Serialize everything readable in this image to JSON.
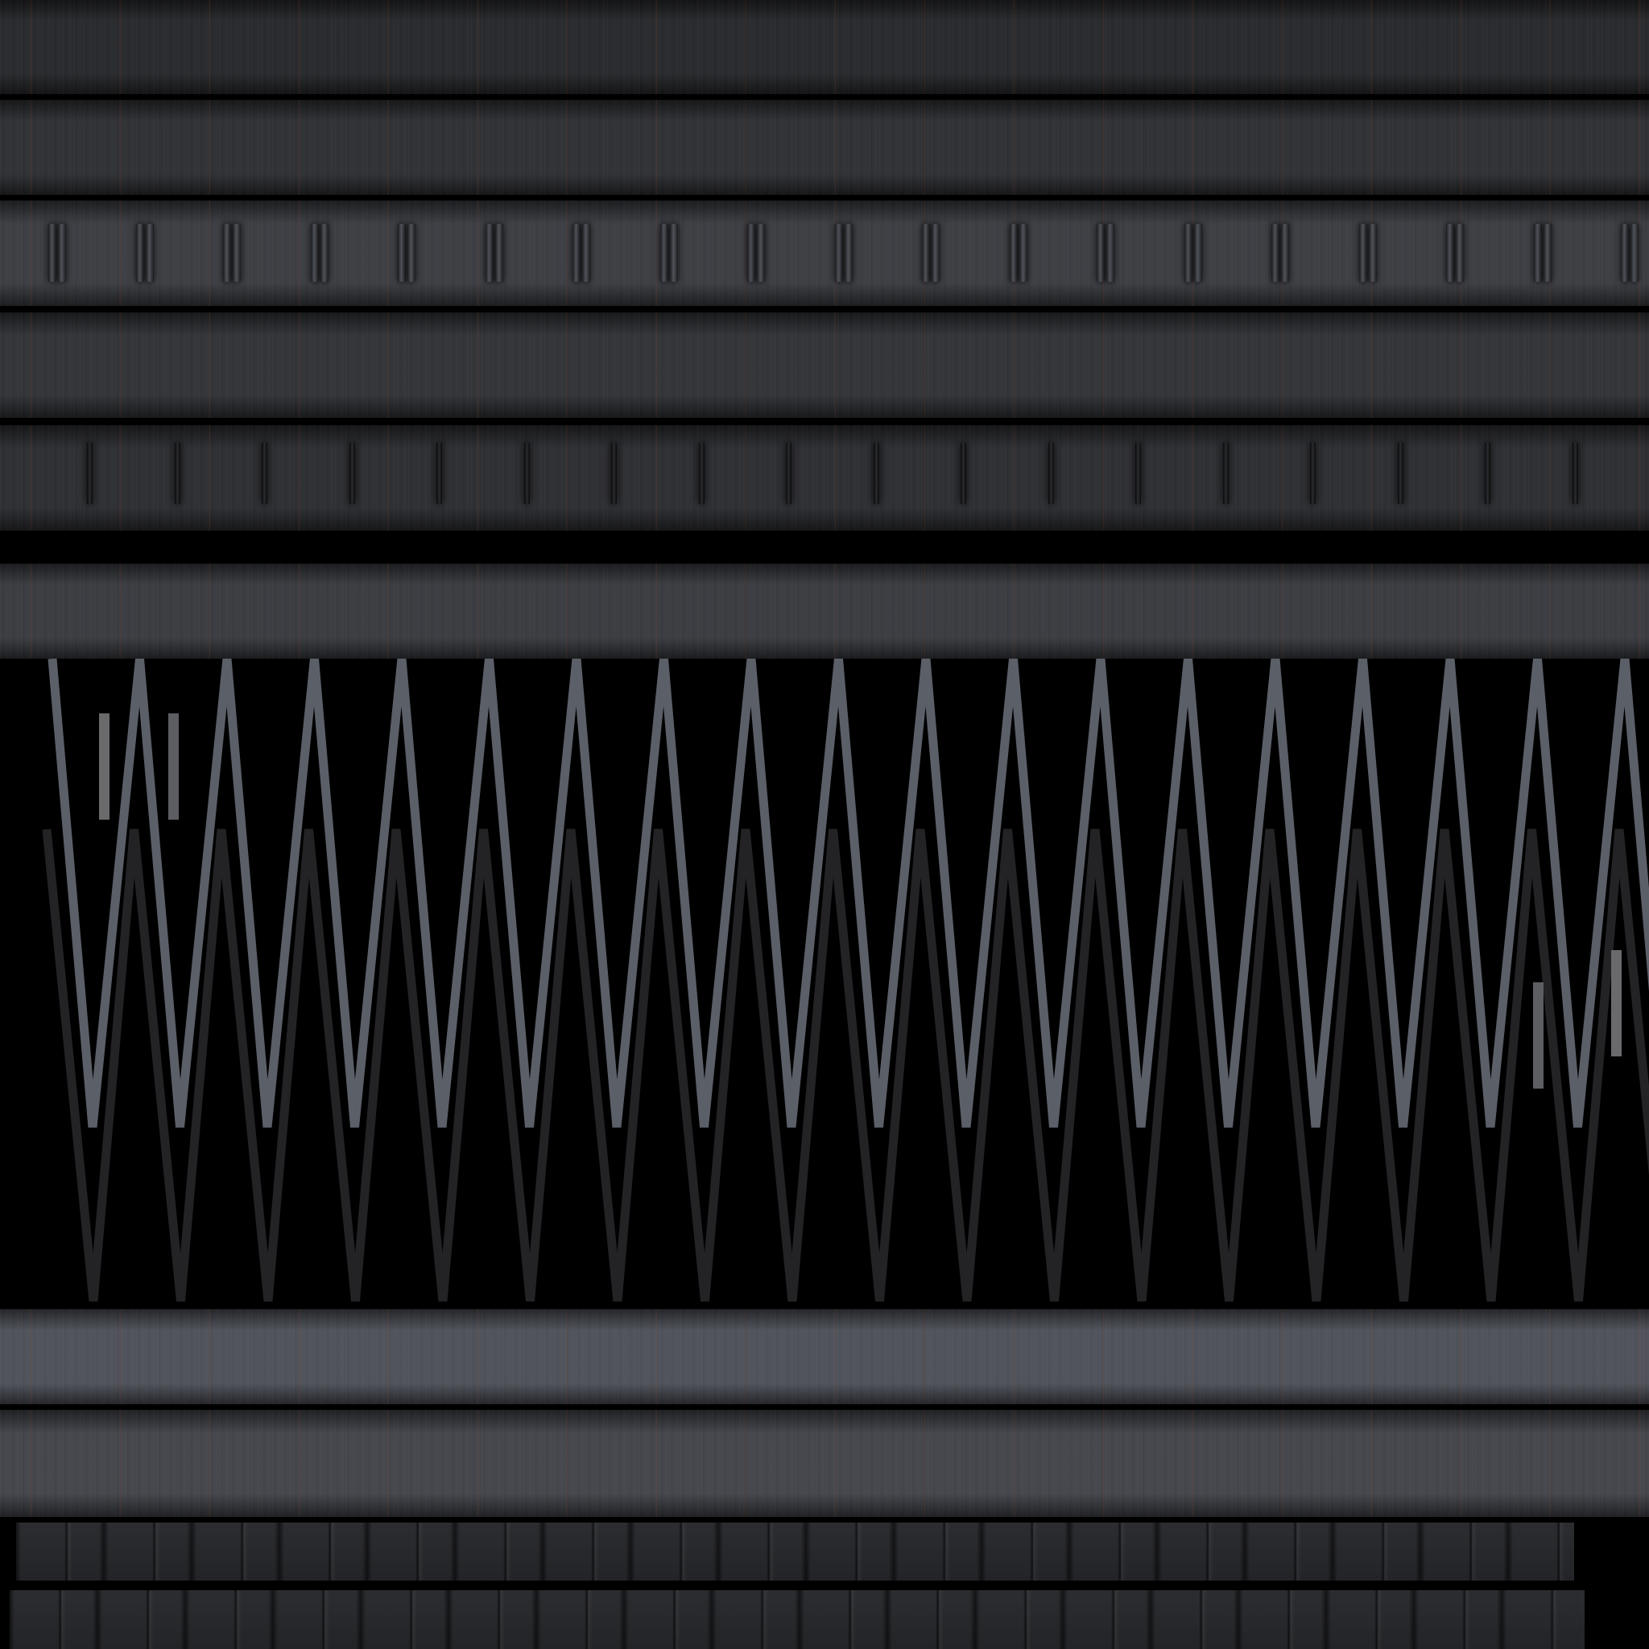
{
  "texture": {
    "panel_count": 8,
    "zigzag_peaks": 19,
    "colors": {
      "background": "#000000",
      "metal_dark": "#2a2b2e",
      "metal_mid": "#3b3d42",
      "metal_light": "#50535b",
      "truss_front": "#5b5f68",
      "truss_back": "#232326",
      "rust": "#8c3c28"
    }
  }
}
